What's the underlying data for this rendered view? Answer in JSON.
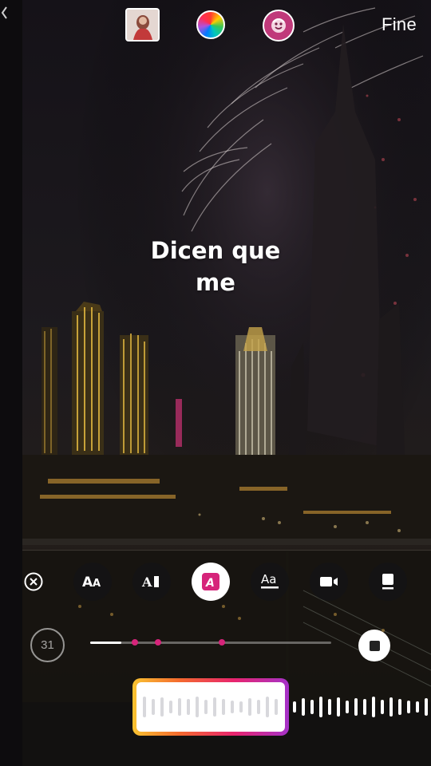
{
  "top_bar": {
    "done_label": "Fine",
    "icons": [
      "album-cover-thumbnail",
      "color-wheel-icon",
      "sticker-face-icon"
    ]
  },
  "lyrics": {
    "line1": "Dicen que",
    "line2": "me"
  },
  "style_bar": {
    "buttons": [
      "close-icon",
      "text-style-aa-icon",
      "text-style-bold-cursor-icon",
      "text-style-italic-a-icon",
      "text-style-underline-aa-icon",
      "video-camera-icon",
      "card-icon"
    ],
    "active_button": "text-style-italic-a-icon",
    "accent_color": "#d6247a"
  },
  "timeline": {
    "duration": "31",
    "progress_fraction": 0.13
  },
  "scrubber": {
    "gradient_colors": [
      "#f9c331",
      "#f46a2e",
      "#e8246e",
      "#a532c9"
    ]
  }
}
